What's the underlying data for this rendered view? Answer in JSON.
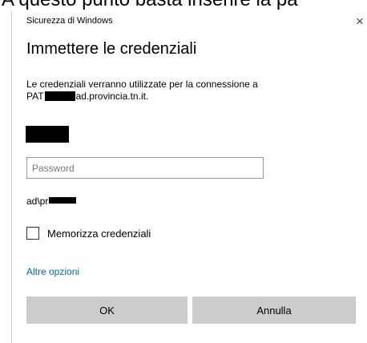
{
  "caption": "A questo punto basta inserire la pa",
  "window": {
    "title": "Sicurezza di Windows",
    "close_glyph": "×"
  },
  "dialog": {
    "heading": "Immettere le credenziali",
    "message_line1": "Le credenziali verranno utilizzate per la connessione a",
    "message_line2_prefix": "PAT",
    "message_line2_suffix": "ad.provincia.tn.it.",
    "password_placeholder": "Password",
    "domain_prefix": "ad\\pr",
    "remember_label": "Memorizza credenziali",
    "remember_checked": false,
    "more_options": "Altre opzioni",
    "ok_label": "OK",
    "cancel_label": "Annulla"
  },
  "colors": {
    "link": "#0067b8",
    "button_bg": "#cccccc",
    "redaction": "#000000"
  }
}
